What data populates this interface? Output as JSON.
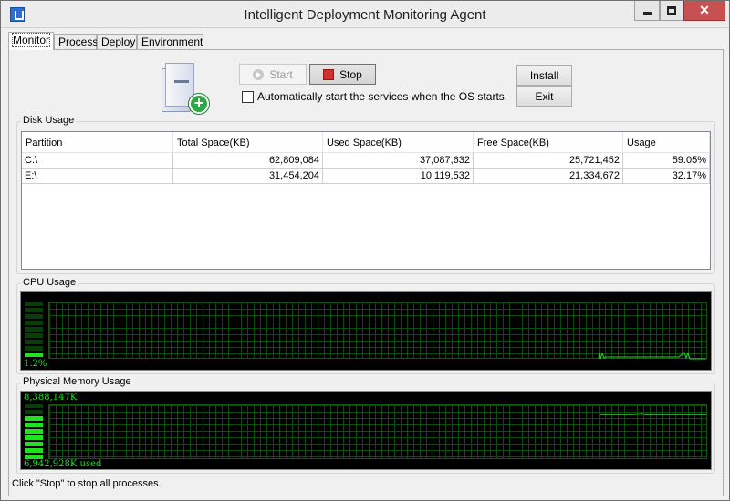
{
  "window": {
    "title": "Intelligent Deployment Monitoring Agent",
    "close_label": "✕"
  },
  "tabs": [
    {
      "label": "Monitor",
      "active": true
    },
    {
      "label": "Process",
      "active": false
    },
    {
      "label": "Deploy",
      "active": false
    },
    {
      "label": "Environment",
      "active": false
    }
  ],
  "monitor": {
    "start_label": "Start",
    "stop_label": "Stop",
    "install_label": "Install",
    "exit_label": "Exit",
    "autostart_label": "Automatically start the services when the OS starts.",
    "autostart_checked": false
  },
  "disk": {
    "title": "Disk Usage",
    "columns": [
      "Partition",
      "Total Space(KB)",
      "Used Space(KB)",
      "Free Space(KB)",
      "Usage"
    ],
    "rows": [
      [
        "C:\\",
        "62,809,084",
        "37,087,632",
        "25,721,452",
        "59.05%"
      ],
      [
        "E:\\",
        "31,454,204",
        "10,119,532",
        "21,334,672",
        "32.17%"
      ]
    ]
  },
  "cpu": {
    "title": "CPU Usage",
    "value_label": "1.2%",
    "level": 0.012
  },
  "memory": {
    "title": "Physical Memory Usage",
    "total_label": "8,388,147K",
    "used_label": "6,942,928K used",
    "level": 0.828
  },
  "status": {
    "text": "Click \"Stop\" to stop all processes."
  },
  "icons": {
    "app": "app-icon",
    "server": "server-icon",
    "plus": "plus-circle-icon"
  },
  "colors": {
    "meter_green": "#22e022",
    "meter_grid": "#0d4d0d",
    "stop_red": "#d32f2f",
    "close_red": "#c75050"
  }
}
